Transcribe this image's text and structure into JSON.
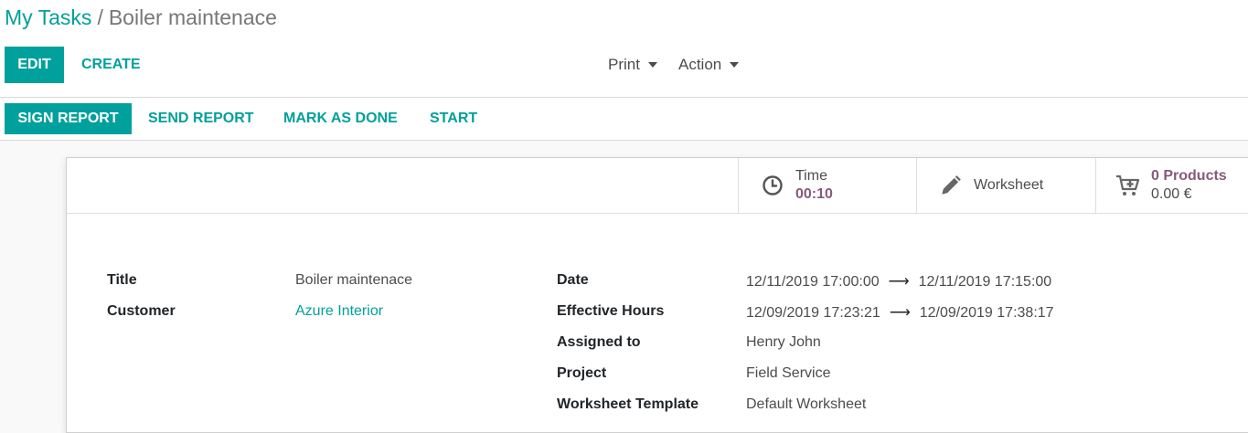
{
  "breadcrumb": {
    "parent": "My Tasks",
    "separator": "/",
    "current": "Boiler maintenace"
  },
  "control_panel": {
    "edit_label": "EDIT",
    "create_label": "CREATE",
    "print_label": "Print",
    "action_label": "Action"
  },
  "statusbar": {
    "sign_report": "SIGN REPORT",
    "send_report": "SEND REPORT",
    "mark_as_done": "MARK AS DONE",
    "start": "START"
  },
  "smart_buttons": {
    "time": {
      "label": "Time",
      "value": "00:10",
      "icon": "clock-icon"
    },
    "worksheet": {
      "label": "Worksheet",
      "icon": "pencil-icon"
    },
    "products": {
      "label": "0 Products",
      "value": "0.00 €",
      "icon": "cart-plus-icon"
    }
  },
  "form": {
    "left": [
      {
        "label": "Title",
        "value": "Boiler maintenace"
      },
      {
        "label": "Customer",
        "value": "Azure Interior"
      }
    ],
    "right": [
      {
        "label": "Date",
        "from": "12/11/2019 17:00:00",
        "to": "12/11/2019 17:15:00"
      },
      {
        "label": "Effective Hours",
        "from": "12/09/2019 17:23:21",
        "to": "12/09/2019 17:38:17"
      },
      {
        "label": "Assigned to",
        "value": "Henry John"
      },
      {
        "label": "Project",
        "value": "Field Service"
      },
      {
        "label": "Worksheet Template",
        "value": "Default Worksheet"
      }
    ]
  },
  "colors": {
    "primary": "#00A09D",
    "accent": "#875A7B",
    "text": "#4c4c4c"
  }
}
